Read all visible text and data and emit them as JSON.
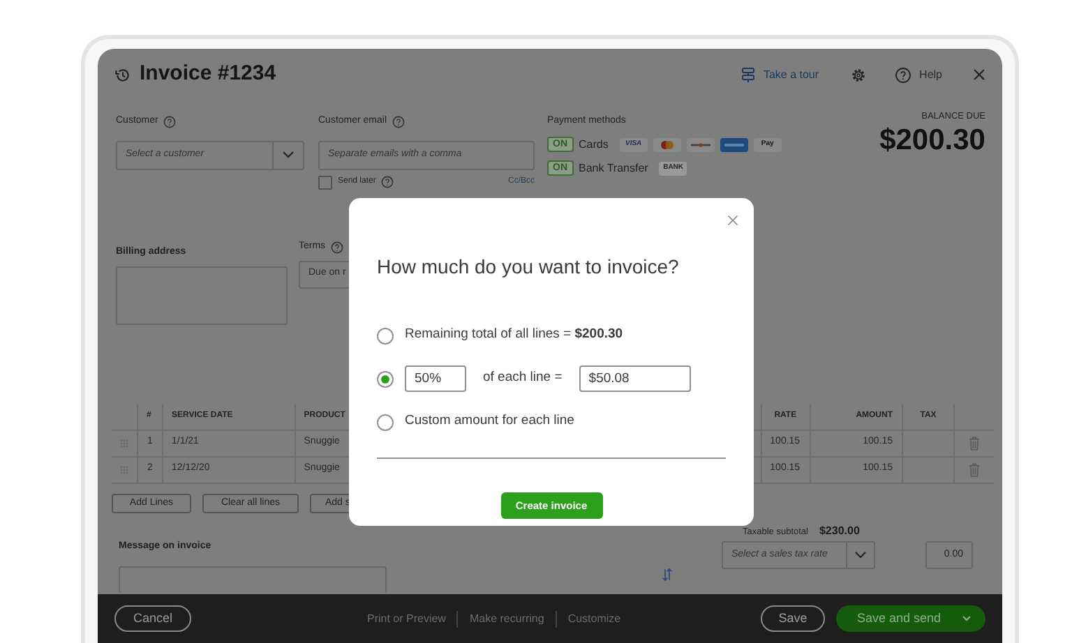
{
  "header": {
    "title": "Invoice #1234",
    "actions": [
      {
        "kind": "tour",
        "label": "Take a tour"
      },
      {
        "kind": "settings"
      },
      {
        "kind": "help",
        "label": "Help"
      },
      {
        "kind": "close"
      }
    ]
  },
  "customer": {
    "label": "Customer",
    "placeholder": "Select a customer"
  },
  "customer_email": {
    "label": "Customer email",
    "placeholder": "Separate emails with a comma",
    "send_later": {
      "label": "Send later",
      "checked": false
    },
    "cc_bcc": "Cc/Bcc"
  },
  "payment_methods": {
    "label": "Payment methods",
    "methods": [
      {
        "badge": "ON",
        "label": "Cards",
        "logos": [
          {
            "kind": "visa",
            "text": "VISA"
          },
          {
            "kind": "mastercard"
          },
          {
            "kind": "discover"
          },
          {
            "kind": "amex"
          },
          {
            "kind": "applepay",
            "text": "Pay"
          }
        ]
      },
      {
        "badge": "ON",
        "label": "Bank Transfer",
        "logos": [
          {
            "kind": "bank",
            "text": "BANK"
          }
        ]
      }
    ]
  },
  "balance_due": {
    "label": "BALANCE DUE",
    "amount": "$200.30"
  },
  "billing_address": {
    "label": "Billing address"
  },
  "terms": {
    "label": "Terms",
    "value": "Due on r"
  },
  "table": {
    "columns": [
      "#",
      "SERVICE DATE",
      "PRODUCT",
      "RATE",
      "AMOUNT",
      "TAX"
    ],
    "rows": [
      {
        "number": "1",
        "service_date": "1/1/21",
        "product": "Snuggie",
        "rate": "100.15",
        "amount": "100.15"
      },
      {
        "number": "2",
        "service_date": "12/12/20",
        "product": "Snuggie",
        "rate": "100.15",
        "amount": "100.15"
      }
    ]
  },
  "table_buttons": [
    "Add Lines",
    "Clear all lines",
    "Add s"
  ],
  "totals": {
    "taxable_subtotal_label": "Taxable subtotal",
    "taxable_subtotal": "$230.00",
    "tax_rate_placeholder": "Select a sales tax rate",
    "tax_amount": "0.00"
  },
  "message": {
    "label": "Message on invoice"
  },
  "footer": {
    "cancel": "Cancel",
    "links": [
      "Print or Preview",
      "Make recurring",
      "Customize"
    ],
    "save": "Save",
    "save_and_send": "Save and send"
  },
  "dialog": {
    "title": "How much do you want to invoice?",
    "options": [
      {
        "kind": "text",
        "text": "Remaining total of all lines = **$200.30**",
        "selected": false
      },
      {
        "kind": "percent",
        "value": "50%",
        "middle": "of each line =",
        "amount": "$50.08",
        "selected": true
      },
      {
        "kind": "text",
        "text": "Custom amount for each line",
        "selected": false
      }
    ],
    "button": "Create invoice"
  }
}
